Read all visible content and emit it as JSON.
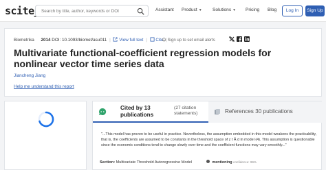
{
  "header": {
    "logo": "scite_",
    "search_placeholder": "Search by title, author, keywords or DOI",
    "nav": {
      "assistant": "Assistant",
      "product": "Product",
      "solutions": "Solutions",
      "pricing": "Pricing",
      "blog": "Blog"
    },
    "login": "Log In",
    "signup": "Sign Up"
  },
  "paper": {
    "journal": "Biometrika",
    "year": "2014",
    "doi": "DOI: 10.1093/biomet/asu011",
    "view_full_text": "View full text",
    "cite": "Cite",
    "sign_up_alerts": "Sign up to set email alerts",
    "title": "Multivariate functional-coefficient regression models for nonlinear vector time series data",
    "author": "Jiancheng Jiang",
    "help_link": "Help me understand this report"
  },
  "citations": {
    "cited_by": "Cited by 13 publications",
    "citation_statements": "(27 citation statements)",
    "references": "References 30 publications",
    "snippet": "\"...This model has proven to be useful in practice. Nevertheless, the assumption embedded in this model weakens the practicability, that is, the coefficients are assumed to be constants in the threshold space of z t Å d in model (4). This assumption is questionable since the economic conditions tend to change slowly over time and the coefficient functions may vary smoothly...\"",
    "section_label": "Section:",
    "section_value": "Multivariate Threshold Autoregressive Model",
    "mentioning": "mentioning",
    "confidence": "confidence: 99%"
  },
  "colors": {
    "accent": "#2f5fb3",
    "spinner": "#1e73e8",
    "cited_icon": "#2fa36b"
  }
}
